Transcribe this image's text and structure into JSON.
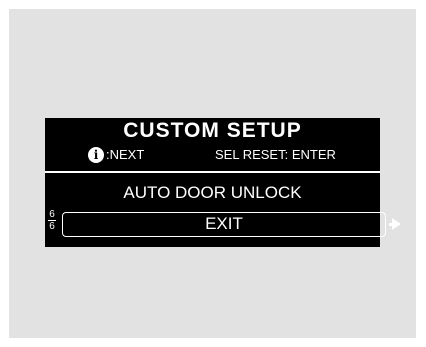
{
  "screen": {
    "title": "CUSTOM SETUP",
    "info_icon_glyph": "i",
    "info_hint": ":NEXT",
    "reset_hint": "SEL RESET: ENTER",
    "options": [
      {
        "label": "AUTO DOOR UNLOCK",
        "selected": false
      },
      {
        "label": "EXIT",
        "selected": true
      }
    ],
    "page": {
      "current": "6",
      "total": "6"
    },
    "icons": {
      "info": "info-icon",
      "select": "arrow-right-icon"
    },
    "colors": {
      "background": "#000000",
      "text": "#ffffff",
      "frame": "#e2e2e2"
    }
  }
}
